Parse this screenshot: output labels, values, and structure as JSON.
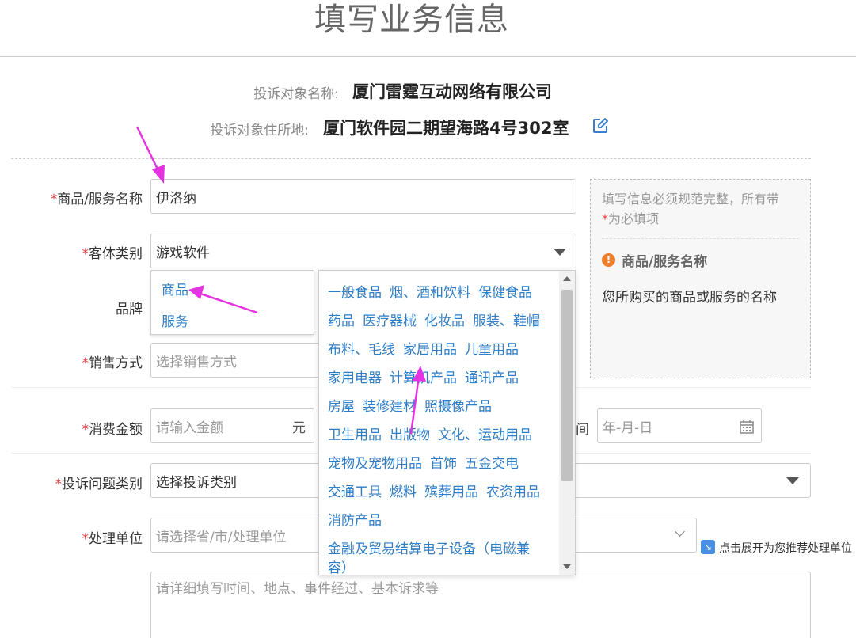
{
  "page": {
    "title": "填写业务信息"
  },
  "target": {
    "name_label": "投诉对象名称:",
    "name_value": "厦门雷霆互动网络有限公司",
    "address_label": "投诉对象住所地:",
    "address_value": "厦门软件园二期望海路4号302室"
  },
  "form": {
    "required_mark": "*",
    "product_label": "商品/服务名称",
    "product_value": "伊洛纳",
    "object_type_label": "客体类别",
    "object_type_value": "游戏软件",
    "brand_label": "品牌",
    "sales_label": "销售方式",
    "sales_placeholder": "选择销售方式",
    "amount_label": "消费金额",
    "amount_placeholder": "请输入金额",
    "amount_unit": "元",
    "date_label_fragment": "间",
    "date_placeholder": "年-月-日",
    "issue_type_label": "投诉问题类别",
    "issue_type_placeholder": "选择投诉类别",
    "handler_label": "处理单位",
    "handler_placeholder": "请选择省/市/处理单位",
    "expand_hint": "点击展开为您推荐处理单位",
    "details_placeholder": "请详细填写时间、地点、事件经过、基本诉求等"
  },
  "help": {
    "note_line1": "填写信息必须规范完整，所有带",
    "note_line2_mark": "*",
    "note_line2": "为必填项",
    "heading": "商品/服务名称",
    "warn_symbol": "!",
    "description": "您所购买的商品或服务的名称",
    "hidden_fragment": "软件"
  },
  "type_dropdown": {
    "options": [
      "商品",
      "服务"
    ]
  },
  "category_dropdown": {
    "items": [
      "一般食品",
      "烟、酒和饮料",
      "保健食品",
      "药品",
      "医疗器械",
      "化妆品",
      "服装、鞋帽",
      "布料、毛线",
      "家居用品",
      "儿童用品",
      "家用电器",
      "计算机产品",
      "通讯产品",
      "房屋",
      "装修建材",
      "照摄像产品",
      "卫生用品",
      "出版物",
      "文化、运动用品",
      "宠物及宠物用品",
      "首饰",
      "五金交电",
      "交通工具",
      "燃料",
      "殡葬用品",
      "农资用品",
      "消防产品",
      "金融及贸易结算电子设备（电磁兼容）"
    ]
  },
  "colors": {
    "link_blue": "#2e7dc5",
    "required_red": "#e4393c",
    "warning_orange": "#ec7f2e",
    "annotation_magenta": "#e433e0"
  },
  "icons": {
    "edit": "edit-icon",
    "warning": "warning-icon",
    "calendar": "calendar-icon",
    "expand": "expand-icon"
  }
}
